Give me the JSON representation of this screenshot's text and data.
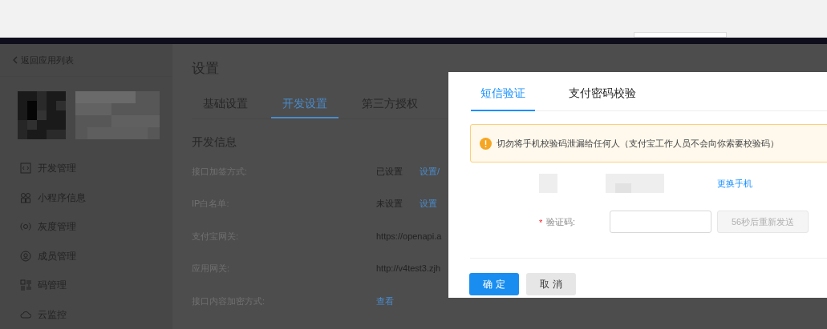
{
  "sidebar": {
    "back_link": "返回应用列表",
    "items": [
      {
        "label": "开发管理"
      },
      {
        "label": "小程序信息"
      },
      {
        "label": "灰度管理"
      },
      {
        "label": "成员管理"
      },
      {
        "label": "码管理"
      },
      {
        "label": "云监控"
      }
    ]
  },
  "main": {
    "title": "设置",
    "tabs": [
      {
        "label": "基础设置",
        "selected": false
      },
      {
        "label": "开发设置",
        "selected": true
      },
      {
        "label": "第三方授权",
        "selected": false
      }
    ],
    "section_title": "开发信息",
    "rows": [
      {
        "label": "接口加签方式:",
        "status": "已设置",
        "link": "设置/"
      },
      {
        "label": "IP白名单:",
        "status": "未设置",
        "link": "设置"
      },
      {
        "label": "支付宝网关:",
        "value": "https://openapi.a"
      },
      {
        "label": "应用网关:",
        "value": "http://v4test3.zjh"
      },
      {
        "label": "接口内容加密方式:",
        "link": "查看"
      }
    ]
  },
  "dialog": {
    "tabs": [
      {
        "label": "短信验证",
        "selected": true
      },
      {
        "label": "支付密码校验",
        "selected": false
      }
    ],
    "alert": "切勿将手机校验码泄漏给任何人（支付宝工作人员不会向你索要校验码）",
    "change_phone_link": "更换手机",
    "required_mark": "*",
    "code_label": "验证码:",
    "resend_button": {
      "label": "56秒后重新发送",
      "disabled": true
    },
    "buttons": [
      {
        "kind": "primary",
        "label": "确 定"
      },
      {
        "kind": "default",
        "label": "取 消"
      }
    ]
  }
}
